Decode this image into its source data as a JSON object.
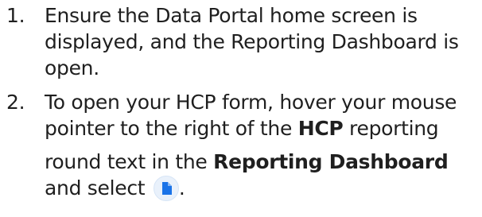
{
  "steps": [
    {
      "number": "1.",
      "text": "Ensure the Data Portal home screen is displayed, and the Reporting Dashboard is open."
    },
    {
      "number": "2.",
      "text_a": "To open your HCP form, hover your mouse pointer to the right of the ",
      "bold_a": "HCP",
      "text_b": " reporting round text in the ",
      "bold_b": "Reporting Dashboard",
      "text_c": " and select ",
      "text_d": "."
    }
  ],
  "icons": {
    "form_icon": "document-icon",
    "form_icon_color": "#1a73e8"
  }
}
